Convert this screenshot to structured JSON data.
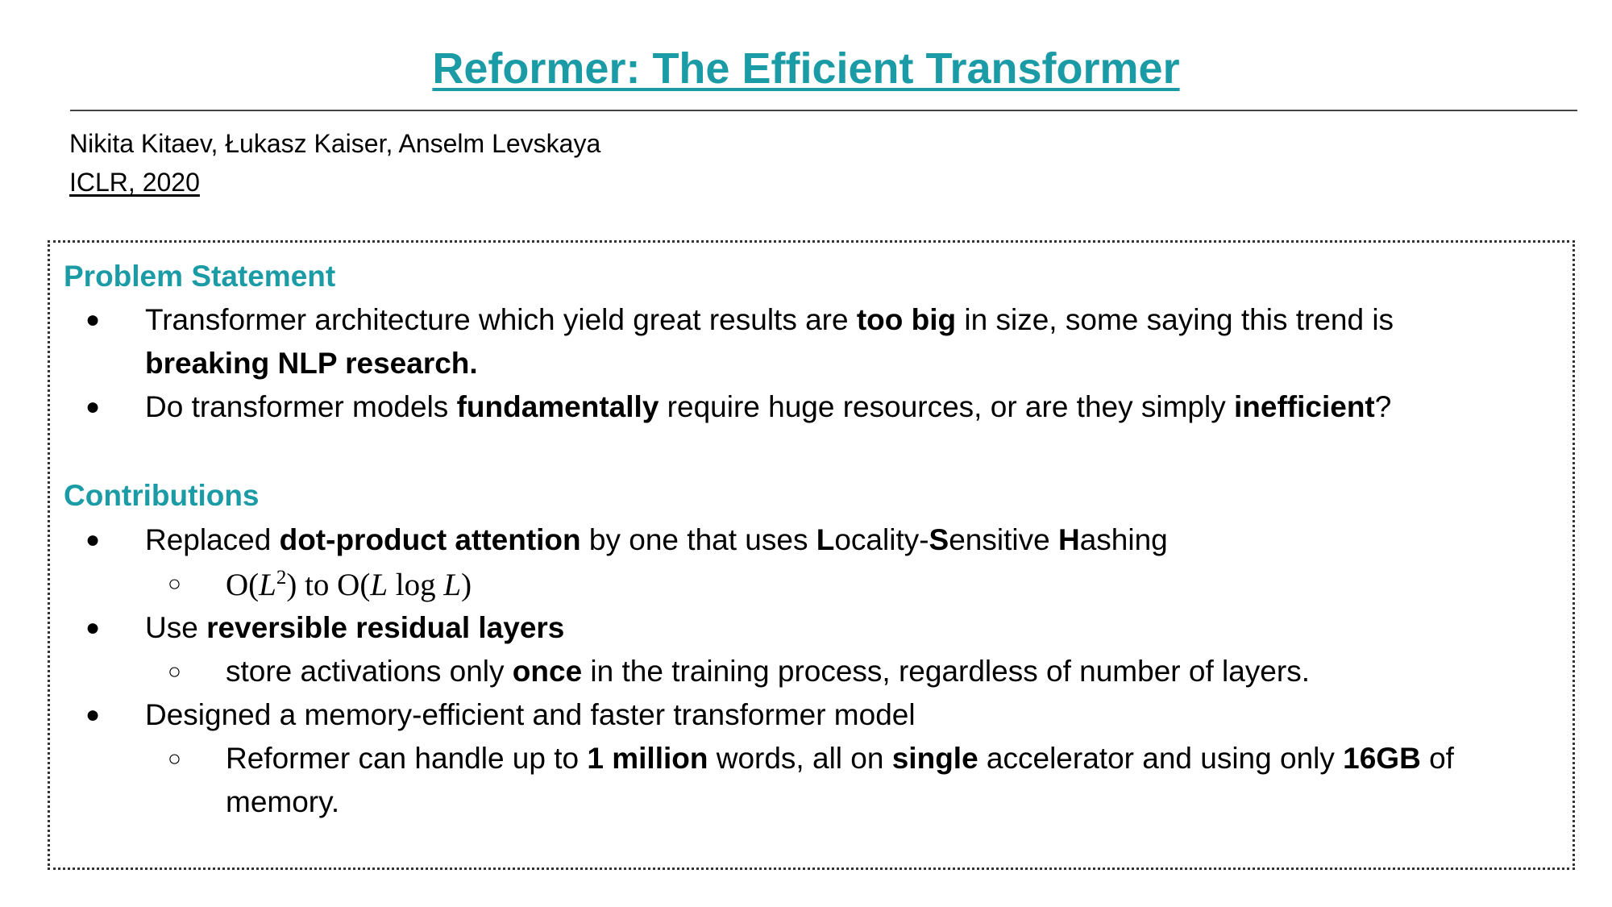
{
  "header": {
    "title": "Reformer: The Efficient Transformer",
    "authors": "Nikita Kitaev, Łukasz Kaiser, Anselm Levskaya",
    "venue": "ICLR, 2020"
  },
  "problem": {
    "heading": "Problem Statement",
    "bullet_glyph": "●",
    "items": [
      {
        "line1": [
          "Transformer architecture which yield great results are ",
          "too big",
          " in size, some saying this trend is"
        ],
        "line2": "breaking NLP research."
      },
      {
        "parts": [
          "Do transformer models ",
          "fundamentally",
          " require huge resources, or are they simply ",
          "inefficient",
          "?"
        ]
      }
    ]
  },
  "contributions": {
    "heading": "Contributions",
    "bullet_glyph": "●",
    "sub_bullet_glyph": "○",
    "items": [
      {
        "parts": [
          "Replaced ",
          "dot-product attention",
          " by one that uses ",
          "L",
          "ocality-",
          "S",
          "ensitive ",
          "H",
          "ashing"
        ],
        "sub": {
          "O1": "O(",
          "L1": "L",
          "exp": "2",
          "mid": ") to O(",
          "L2": "L",
          "log": " log ",
          "L3": "L",
          "end": ")"
        }
      },
      {
        "parts": [
          "Use ",
          "reversible residual layers"
        ],
        "sub": [
          "store activations only ",
          "once",
          " in the training process, regardless of number of layers."
        ]
      },
      {
        "text": "Designed a memory-efficient and faster transformer model",
        "sub": {
          "line1": [
            "Reformer can handle up to ",
            "1 million",
            " words, all on ",
            "single",
            " accelerator and using only ",
            "16GB",
            " of"
          ],
          "line2": "memory."
        }
      }
    ]
  }
}
